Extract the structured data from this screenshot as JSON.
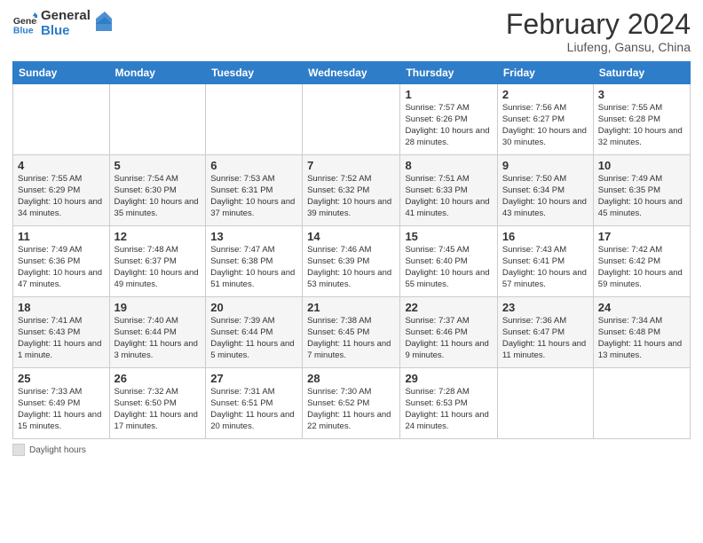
{
  "header": {
    "logo_line1": "General",
    "logo_line2": "Blue",
    "month_title": "February 2024",
    "location": "Liufeng, Gansu, China"
  },
  "days_of_week": [
    "Sunday",
    "Monday",
    "Tuesday",
    "Wednesday",
    "Thursday",
    "Friday",
    "Saturday"
  ],
  "weeks": [
    [
      {
        "day": "",
        "info": ""
      },
      {
        "day": "",
        "info": ""
      },
      {
        "day": "",
        "info": ""
      },
      {
        "day": "",
        "info": ""
      },
      {
        "day": "1",
        "info": "Sunrise: 7:57 AM\nSunset: 6:26 PM\nDaylight: 10 hours\nand 28 minutes."
      },
      {
        "day": "2",
        "info": "Sunrise: 7:56 AM\nSunset: 6:27 PM\nDaylight: 10 hours\nand 30 minutes."
      },
      {
        "day": "3",
        "info": "Sunrise: 7:55 AM\nSunset: 6:28 PM\nDaylight: 10 hours\nand 32 minutes."
      }
    ],
    [
      {
        "day": "4",
        "info": "Sunrise: 7:55 AM\nSunset: 6:29 PM\nDaylight: 10 hours\nand 34 minutes."
      },
      {
        "day": "5",
        "info": "Sunrise: 7:54 AM\nSunset: 6:30 PM\nDaylight: 10 hours\nand 35 minutes."
      },
      {
        "day": "6",
        "info": "Sunrise: 7:53 AM\nSunset: 6:31 PM\nDaylight: 10 hours\nand 37 minutes."
      },
      {
        "day": "7",
        "info": "Sunrise: 7:52 AM\nSunset: 6:32 PM\nDaylight: 10 hours\nand 39 minutes."
      },
      {
        "day": "8",
        "info": "Sunrise: 7:51 AM\nSunset: 6:33 PM\nDaylight: 10 hours\nand 41 minutes."
      },
      {
        "day": "9",
        "info": "Sunrise: 7:50 AM\nSunset: 6:34 PM\nDaylight: 10 hours\nand 43 minutes."
      },
      {
        "day": "10",
        "info": "Sunrise: 7:49 AM\nSunset: 6:35 PM\nDaylight: 10 hours\nand 45 minutes."
      }
    ],
    [
      {
        "day": "11",
        "info": "Sunrise: 7:49 AM\nSunset: 6:36 PM\nDaylight: 10 hours\nand 47 minutes."
      },
      {
        "day": "12",
        "info": "Sunrise: 7:48 AM\nSunset: 6:37 PM\nDaylight: 10 hours\nand 49 minutes."
      },
      {
        "day": "13",
        "info": "Sunrise: 7:47 AM\nSunset: 6:38 PM\nDaylight: 10 hours\nand 51 minutes."
      },
      {
        "day": "14",
        "info": "Sunrise: 7:46 AM\nSunset: 6:39 PM\nDaylight: 10 hours\nand 53 minutes."
      },
      {
        "day": "15",
        "info": "Sunrise: 7:45 AM\nSunset: 6:40 PM\nDaylight: 10 hours\nand 55 minutes."
      },
      {
        "day": "16",
        "info": "Sunrise: 7:43 AM\nSunset: 6:41 PM\nDaylight: 10 hours\nand 57 minutes."
      },
      {
        "day": "17",
        "info": "Sunrise: 7:42 AM\nSunset: 6:42 PM\nDaylight: 10 hours\nand 59 minutes."
      }
    ],
    [
      {
        "day": "18",
        "info": "Sunrise: 7:41 AM\nSunset: 6:43 PM\nDaylight: 11 hours\nand 1 minute."
      },
      {
        "day": "19",
        "info": "Sunrise: 7:40 AM\nSunset: 6:44 PM\nDaylight: 11 hours\nand 3 minutes."
      },
      {
        "day": "20",
        "info": "Sunrise: 7:39 AM\nSunset: 6:44 PM\nDaylight: 11 hours\nand 5 minutes."
      },
      {
        "day": "21",
        "info": "Sunrise: 7:38 AM\nSunset: 6:45 PM\nDaylight: 11 hours\nand 7 minutes."
      },
      {
        "day": "22",
        "info": "Sunrise: 7:37 AM\nSunset: 6:46 PM\nDaylight: 11 hours\nand 9 minutes."
      },
      {
        "day": "23",
        "info": "Sunrise: 7:36 AM\nSunset: 6:47 PM\nDaylight: 11 hours\nand 11 minutes."
      },
      {
        "day": "24",
        "info": "Sunrise: 7:34 AM\nSunset: 6:48 PM\nDaylight: 11 hours\nand 13 minutes."
      }
    ],
    [
      {
        "day": "25",
        "info": "Sunrise: 7:33 AM\nSunset: 6:49 PM\nDaylight: 11 hours\nand 15 minutes."
      },
      {
        "day": "26",
        "info": "Sunrise: 7:32 AM\nSunset: 6:50 PM\nDaylight: 11 hours\nand 17 minutes."
      },
      {
        "day": "27",
        "info": "Sunrise: 7:31 AM\nSunset: 6:51 PM\nDaylight: 11 hours\nand 20 minutes."
      },
      {
        "day": "28",
        "info": "Sunrise: 7:30 AM\nSunset: 6:52 PM\nDaylight: 11 hours\nand 22 minutes."
      },
      {
        "day": "29",
        "info": "Sunrise: 7:28 AM\nSunset: 6:53 PM\nDaylight: 11 hours\nand 24 minutes."
      },
      {
        "day": "",
        "info": ""
      },
      {
        "day": "",
        "info": ""
      }
    ]
  ],
  "footer": {
    "legend_label": "Daylight hours"
  }
}
